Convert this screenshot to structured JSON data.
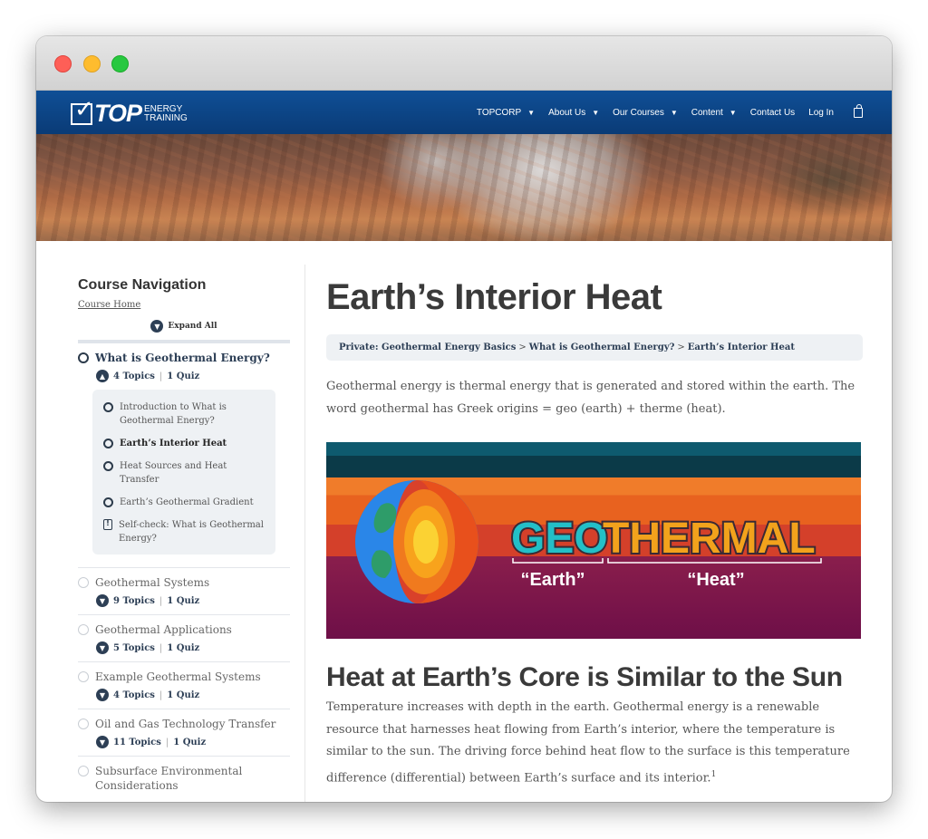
{
  "nav": {
    "logo_top": "TOP",
    "logo_sub_1": "ENERGY",
    "logo_sub_2": "TRAINING",
    "items": [
      {
        "label": "TOPCORP",
        "dropdown": true
      },
      {
        "label": "About Us",
        "dropdown": true
      },
      {
        "label": "Our Courses",
        "dropdown": true
      },
      {
        "label": "Content",
        "dropdown": true
      },
      {
        "label": "Contact Us",
        "dropdown": false
      },
      {
        "label": "Log In",
        "dropdown": false
      }
    ]
  },
  "sidebar": {
    "title": "Course Navigation",
    "course_home": "Course Home",
    "expand_all": "Expand All",
    "lessons": [
      {
        "title": "What is Geothermal Energy?",
        "topics_count": "4 Topics",
        "quiz_count": "1 Quiz",
        "expanded": true,
        "topics": [
          {
            "label": "Introduction to What is Geothermal Energy?",
            "type": "topic"
          },
          {
            "label": "Earth’s Interior Heat",
            "type": "topic",
            "current": true
          },
          {
            "label": "Heat Sources and Heat Transfer",
            "type": "topic"
          },
          {
            "label": "Earth’s Geothermal Gradient",
            "type": "topic"
          },
          {
            "label": "Self-check: What is Geothermal Energy?",
            "type": "quiz"
          }
        ]
      },
      {
        "title": "Geothermal Systems",
        "topics_count": "9 Topics",
        "quiz_count": "1 Quiz"
      },
      {
        "title": "Geothermal Applications",
        "topics_count": "5 Topics",
        "quiz_count": "1 Quiz"
      },
      {
        "title": "Example Geothermal Systems",
        "topics_count": "4 Topics",
        "quiz_count": "1 Quiz"
      },
      {
        "title": "Oil and Gas Technology Transfer",
        "topics_count": "11 Topics",
        "quiz_count": "1 Quiz"
      },
      {
        "title": "Subsurface Environmental Considerations"
      }
    ]
  },
  "main": {
    "title": "Earth’s Interior Heat",
    "breadcrumb": [
      "Private: Geothermal Energy Basics",
      "What is Geothermal Energy?",
      "Earth’s Interior Heat"
    ],
    "intro": "Geothermal energy is thermal energy that is generated and stored within the earth. The word geothermal has Greek origins = geo (earth) + therme (heat).",
    "banner": {
      "word_geo": "GEO",
      "word_thermal": "THERMAL",
      "label_earth": "“Earth”",
      "label_heat": "“Heat”"
    },
    "heading2": "Heat at Earth’s Core is Similar to the Sun",
    "body": "Temperature increases with depth in the earth. Geothermal energy is a renewable resource that harnesses heat flowing from Earth’s interior, where the temperature is similar to the sun. The driving force behind heat flow to the surface is this temperature difference (differential) between Earth’s surface and its interior.",
    "footnote": "1"
  }
}
